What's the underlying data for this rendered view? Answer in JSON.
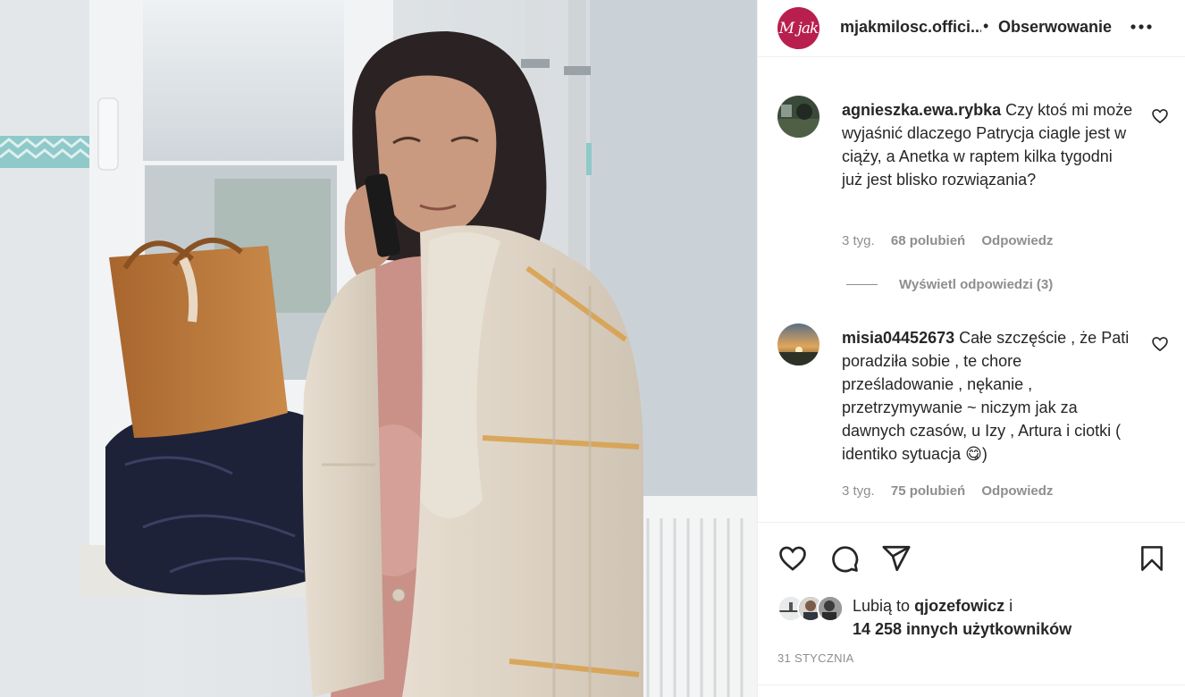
{
  "post": {
    "username": "mjakmilosc.offici...",
    "separator": "•",
    "follow_label": "Obserwowanie",
    "more_icon": "more-horizontal-icon",
    "avatar_text": "M jak"
  },
  "comments": [
    {
      "username": "agnieszka.ewa.rybka",
      "text": "Czy ktoś mi może wyjaśnić dlaczego Patrycja ciagle jest w ciąży, a Anetka w raptem kilka tygodni już jest blisko rozwiązania?",
      "time": "3 tyg.",
      "likes": "68 polubień",
      "reply_label": "Odpowiedz",
      "view_replies": "Wyświetl odpowiedzi (3)"
    },
    {
      "username": "misia04452673",
      "text": "Całe szczęście , że Pati poradziła sobie , te chore prześladowanie , nękanie , przetrzymywanie ~ niczym jak za dawnych czasów, u Izy , Artura i ciotki ( identiko sytuacja 😋)",
      "time": "3 tyg.",
      "likes": "75 polubień",
      "reply_label": "Odpowiedz"
    }
  ],
  "likes": {
    "prefix": "Lubią to",
    "user": "qjozefowicz",
    "suffix": "i",
    "others": "14 258 innych użytkowników"
  },
  "date": "31 STYCZNIA",
  "colors": {
    "brand_avatar": "#b81f4f",
    "text": "#262626",
    "muted": "#8e8e8e",
    "divider": "#efefef"
  }
}
